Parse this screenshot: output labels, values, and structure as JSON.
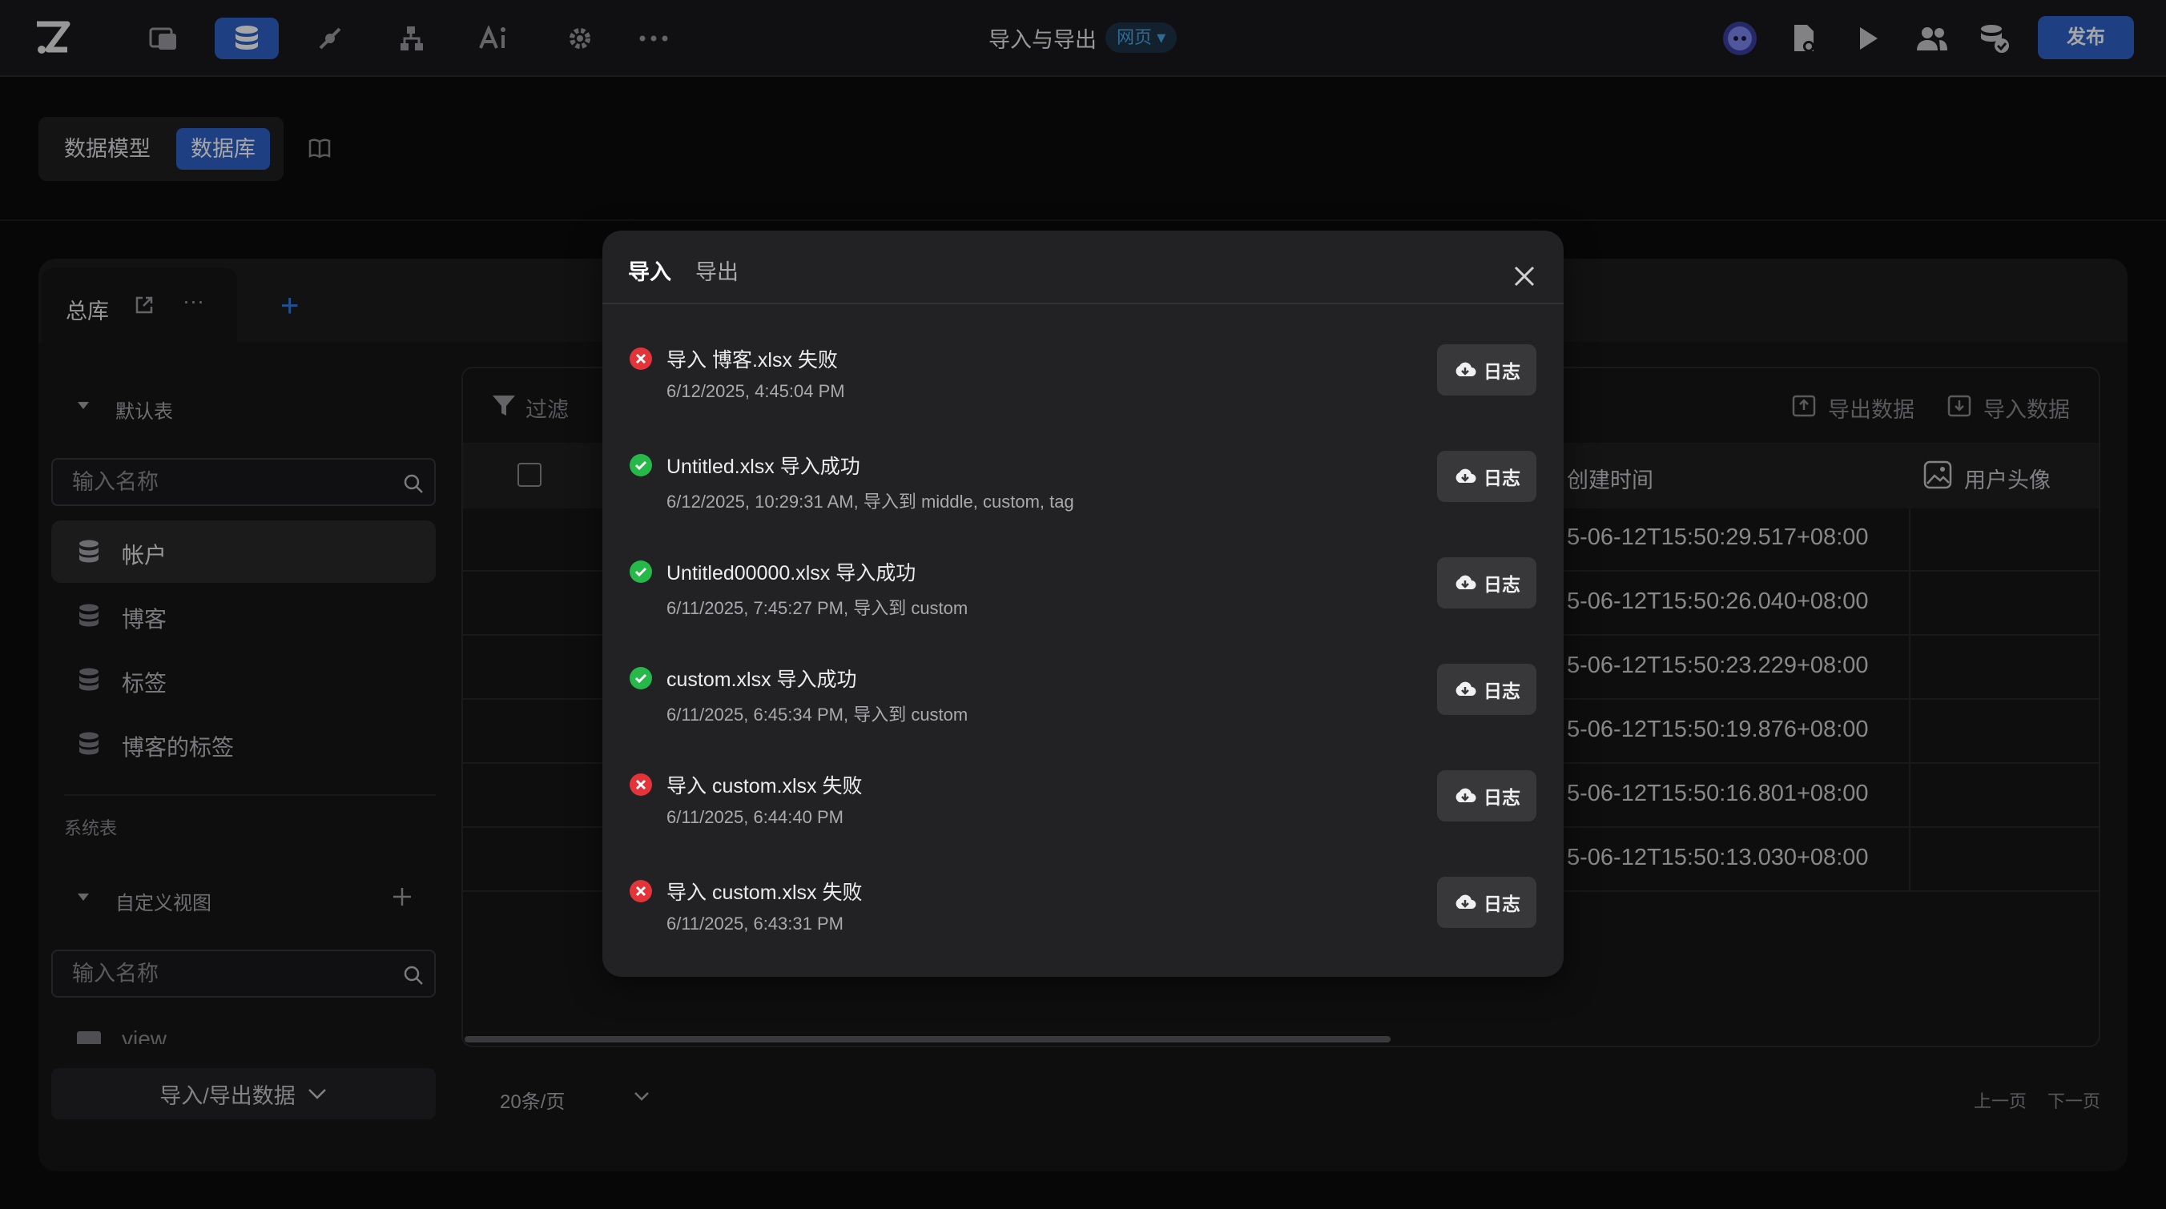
{
  "topbar": {
    "title": "导入与导出",
    "badge": "网页 ▾",
    "publish": "发布"
  },
  "subbar": {
    "data_model": "数据模型",
    "database": "数据库"
  },
  "db_tab": {
    "label": "总库",
    "more": "···",
    "add": "+"
  },
  "sidebar": {
    "default_tables": "默认表",
    "search_placeholder": "输入名称",
    "tables": [
      "帐户",
      "博客",
      "标签",
      "博客的标签"
    ],
    "system_tables": "系统表",
    "custom_views": "自定义视图",
    "views_search_placeholder": "输入名称",
    "view_item": "view",
    "import_export": "导入/导出数据"
  },
  "table": {
    "filter": "过滤",
    "export_data": "导出数据",
    "import_data": "导入数据",
    "col_created": "创建时间",
    "col_avatar": "用户头像",
    "created_values": [
      "5-06-12T15:50:29.517+08:00",
      "5-06-12T15:50:26.040+08:00",
      "5-06-12T15:50:23.229+08:00",
      "5-06-12T15:50:19.876+08:00",
      "5-06-12T15:50:16.801+08:00",
      "5-06-12T15:50:13.030+08:00"
    ],
    "page_size": "20条/页",
    "prev": "上一页",
    "next": "下一页"
  },
  "modal": {
    "tab_import": "导入",
    "tab_export": "导出",
    "log_label": "日志",
    "items": [
      {
        "status": "fail",
        "title": "导入 博客.xlsx 失败",
        "meta": "6/12/2025, 4:45:04 PM"
      },
      {
        "status": "ok",
        "title": "Untitled.xlsx 导入成功",
        "meta": "6/12/2025, 10:29:31 AM, 导入到 middle, custom, tag"
      },
      {
        "status": "ok",
        "title": "Untitled00000.xlsx 导入成功",
        "meta": "6/11/2025, 7:45:27 PM, 导入到 custom"
      },
      {
        "status": "ok",
        "title": "custom.xlsx 导入成功",
        "meta": "6/11/2025, 6:45:34 PM, 导入到 custom"
      },
      {
        "status": "fail",
        "title": "导入 custom.xlsx 失败",
        "meta": "6/11/2025, 6:44:40 PM"
      },
      {
        "status": "fail",
        "title": "导入 custom.xlsx 失败",
        "meta": "6/11/2025, 6:43:31 PM"
      }
    ]
  },
  "colors": {
    "accent": "#2f63c8",
    "success": "#27b84a",
    "error": "#e3343a",
    "badge_text": "#48a6e6"
  },
  "icons": [
    "logo-icon",
    "pages-icon",
    "database-icon",
    "flow-icon",
    "workflow-icon",
    "ai-icon",
    "settings-icon",
    "more-icon",
    "avatar-icon",
    "file-settings-icon",
    "play-icon",
    "users-icon",
    "db-check-icon"
  ]
}
